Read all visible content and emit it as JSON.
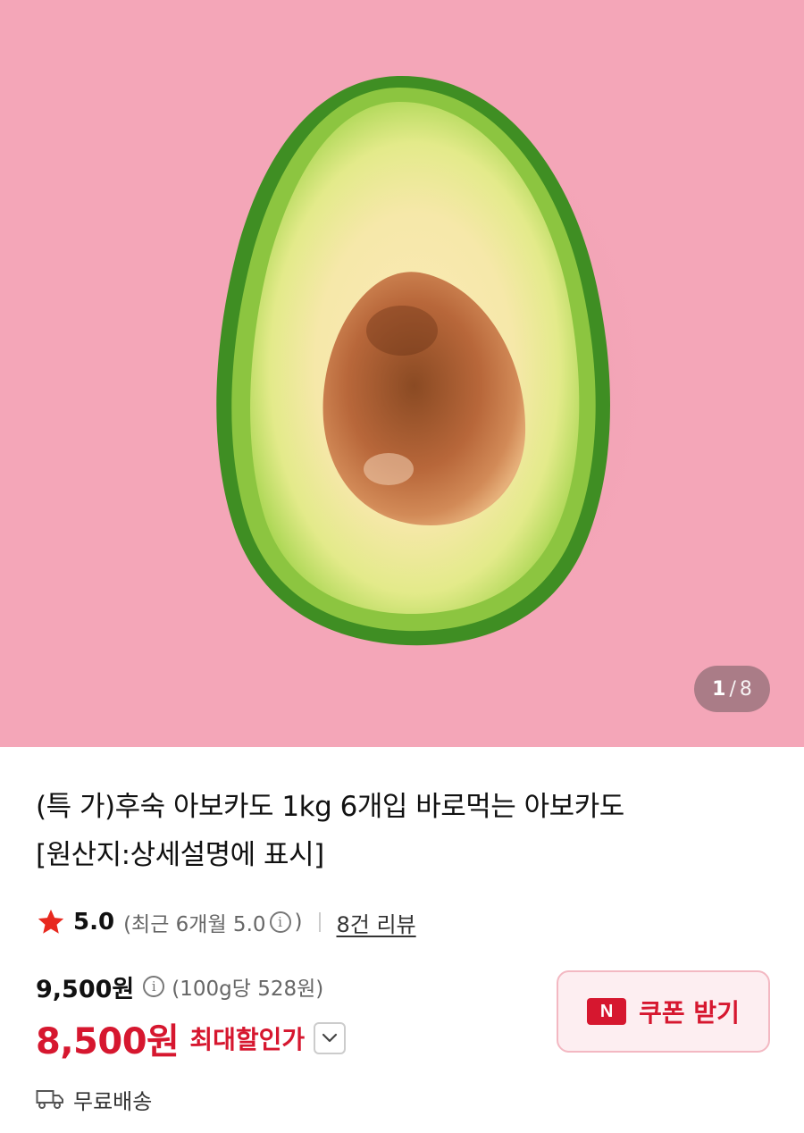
{
  "gallery": {
    "current": "1",
    "separator": "/",
    "total": "8",
    "background_color": "#f4a6b8",
    "image_subject": "avocado-half-icon"
  },
  "product": {
    "title_line1": "(특 가)후숙 아보카도 1kg 6개입 바로먹는 아보카도",
    "title_line2": "[원산지:상세설명에 표시]"
  },
  "rating": {
    "score": "5.0",
    "recent_open": "(최근 6개월 5.0",
    "recent_close": ")",
    "info_glyph": "i",
    "review_link": "8건 리뷰",
    "star_color": "#e8291f"
  },
  "price": {
    "original": "9,500원",
    "info_glyph": "i",
    "unit_price": "(100g당 528원)",
    "sale": "8,500원",
    "sale_label": "최대할인가",
    "accent_color": "#d6172f"
  },
  "coupon": {
    "badge": "N",
    "label": "쿠폰 받기"
  },
  "shipping": {
    "label": "무료배송"
  }
}
